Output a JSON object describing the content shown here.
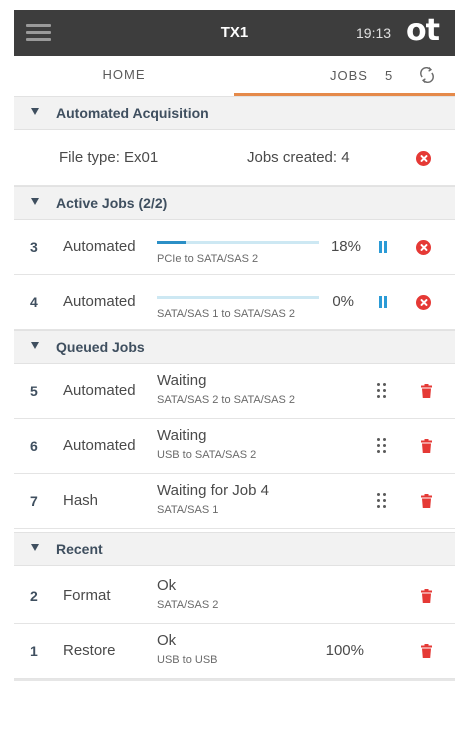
{
  "header": {
    "device_name": "TX1",
    "time": "19:13",
    "logo_text": "ot"
  },
  "tabs": {
    "home_label": "HOME",
    "jobs_label": "JOBS",
    "jobs_count": "5"
  },
  "sections": {
    "acquisition": {
      "title": "Automated Acquisition",
      "file_type": "File type: Ex01",
      "jobs_created": "Jobs created: 4"
    },
    "active": {
      "title": "Active Jobs (2/2)",
      "jobs": [
        {
          "num": "3",
          "kind": "Automated",
          "route": "PCIe to SATA/SAS 2",
          "percent": "18%",
          "progress": 0.18
        },
        {
          "num": "4",
          "kind": "Automated",
          "route": "SATA/SAS 1 to SATA/SAS 2",
          "percent": "0%",
          "progress": 0.0
        }
      ]
    },
    "queued": {
      "title": "Queued Jobs",
      "jobs": [
        {
          "num": "5",
          "kind": "Automated",
          "status": "Waiting",
          "route": "SATA/SAS 2 to SATA/SAS 2"
        },
        {
          "num": "6",
          "kind": "Automated",
          "status": "Waiting",
          "route": "USB to SATA/SAS 2"
        },
        {
          "num": "7",
          "kind": "Hash",
          "status": "Waiting for Job 4",
          "route": "SATA/SAS 1"
        }
      ]
    },
    "recent": {
      "title": "Recent",
      "jobs": [
        {
          "num": "2",
          "kind": "Format",
          "status": "Ok",
          "route": "SATA/SAS 2",
          "percent": ""
        },
        {
          "num": "1",
          "kind": "Restore",
          "status": "Ok",
          "route": "USB to USB",
          "percent": "100%"
        }
      ]
    }
  },
  "colors": {
    "topbar": "#3d3d3d",
    "accent_tab": "#e58a4a",
    "progress": "#2b8fc6",
    "danger": "#e53935",
    "section_text": "#3f4f5f"
  }
}
